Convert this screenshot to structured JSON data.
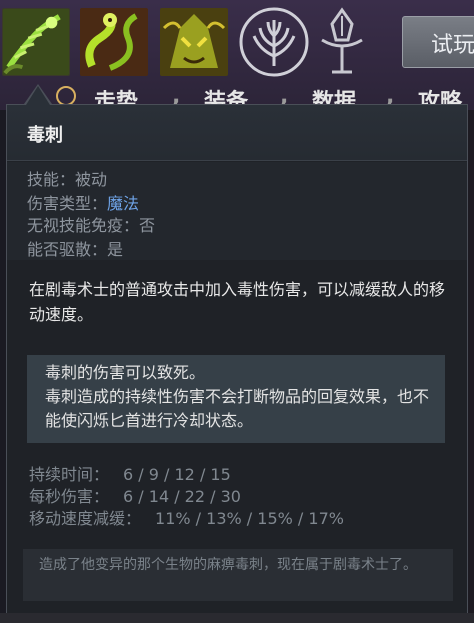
{
  "header": {
    "skill_icons": [
      {
        "name": "poison-sting-icon",
        "accent": "#8fd13a"
      },
      {
        "name": "venomous-coil-icon",
        "accent": "#b5e02a"
      },
      {
        "name": "serpent-mask-icon",
        "accent": "#d4c030"
      }
    ],
    "talent_icon": "talent-tree-icon",
    "scepter_icon": "aghanims-scepter-icon",
    "try_button_label": "试玩",
    "tabs": [
      "走势",
      "装备",
      "数据",
      "攻略"
    ]
  },
  "tooltip": {
    "title": "毒刺",
    "properties": [
      {
        "label": "技能：",
        "value": "被动",
        "highlight": false
      },
      {
        "label": "伤害类型：",
        "value": "魔法",
        "highlight": true
      },
      {
        "label": "无视技能免疫：",
        "value": "否",
        "highlight": false
      },
      {
        "label": "能否驱散：",
        "value": "是",
        "highlight": false
      }
    ],
    "description": "在剧毒术士的普通攻击中加入毒性伤害，可以减缓敌人的移动速度。",
    "note": "毒刺的伤害可以致死。\n毒刺造成的持续性伤害不会打断物品的回复效果，也不能使闪烁匕首进行冷却状态。",
    "stats": [
      {
        "label": "持续时间：",
        "value": "6 / 9 / 12 / 15"
      },
      {
        "label": "每秒伤害：",
        "value": "6 / 14 / 22 / 30"
      },
      {
        "label": "移动速度减缓：",
        "value": "11% / 13% / 15% / 17%"
      }
    ],
    "lore": "造成了他变异的那个生物的麻痹毒刺，现在属于剧毒术士了。"
  },
  "colors": {
    "highlight_blue": "#6fa4e8",
    "tooltip_bg": "#1f2227",
    "note_bg": "#364048"
  }
}
